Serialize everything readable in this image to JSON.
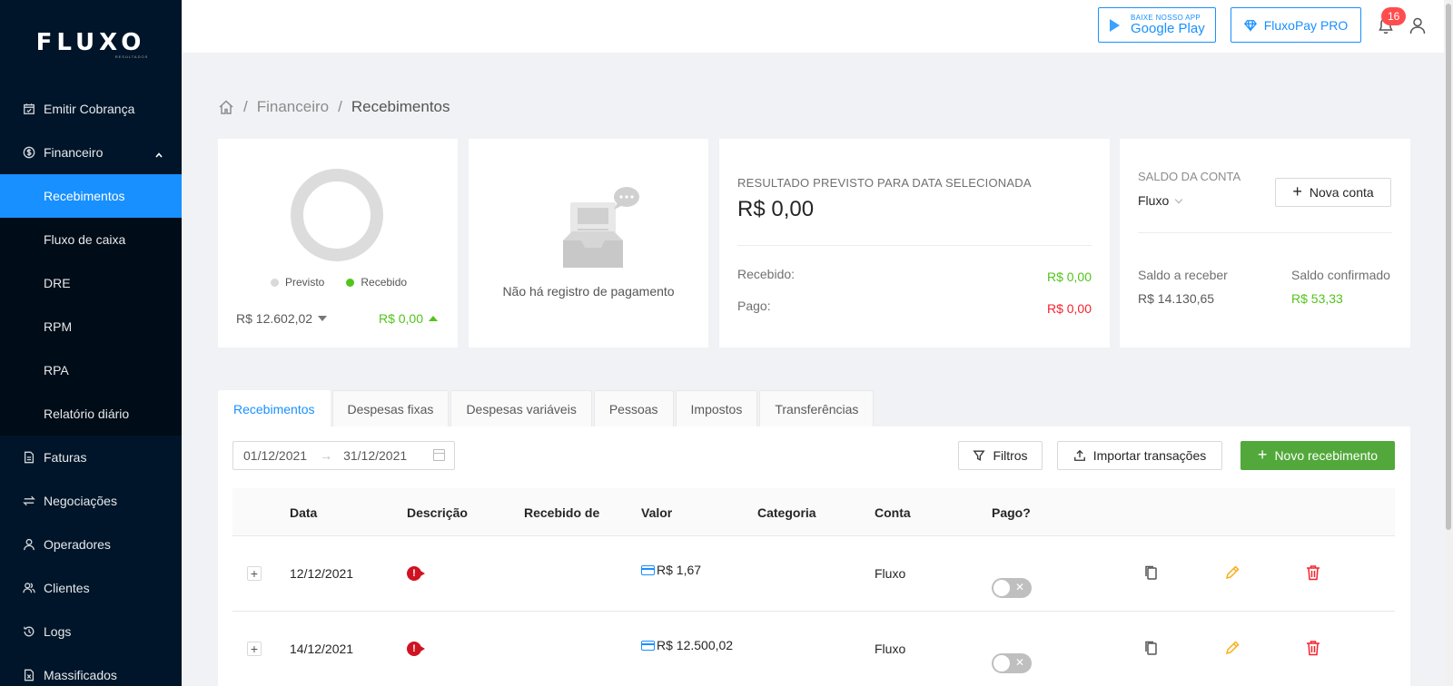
{
  "brand": {
    "logo": "FLUXO",
    "logo_sub": "RESULTADOS"
  },
  "sidebar": {
    "items": [
      {
        "label": "Emitir Cobrança",
        "icon": "calendar-icon"
      },
      {
        "label": "Financeiro",
        "icon": "dollar-icon",
        "expanded": true
      },
      {
        "label": "Faturas",
        "icon": "file-icon"
      },
      {
        "label": "Negociações",
        "icon": "swap-icon"
      },
      {
        "label": "Operadores",
        "icon": "user-icon"
      },
      {
        "label": "Clientes",
        "icon": "team-icon"
      },
      {
        "label": "Logs",
        "icon": "history-icon"
      },
      {
        "label": "Massificados",
        "icon": "file-excel-icon"
      }
    ],
    "submenu": [
      {
        "label": "Recebimentos",
        "active": true
      },
      {
        "label": "Fluxo de caixa"
      },
      {
        "label": "DRE"
      },
      {
        "label": "RPM"
      },
      {
        "label": "RPA"
      },
      {
        "label": "Relatório diário"
      }
    ]
  },
  "header": {
    "gplay_small": "BAIXE NOSSO APP",
    "gplay_big": "Google Play",
    "pro_label": "FluxoPay PRO",
    "notifications": "16"
  },
  "breadcrumb": {
    "items": [
      "Financeiro",
      "Recebimentos"
    ],
    "sep": "/"
  },
  "summary": {
    "legend_prev": "Previsto",
    "legend_rec": "Recebido",
    "prev_value": "R$ 12.602,02",
    "rec_value": "R$ 0,00",
    "colors": {
      "prev": "#d9d9d9",
      "rec": "#52c41a"
    }
  },
  "empty": {
    "text": "Não há registro de pagamento"
  },
  "result": {
    "label": "RESULTADO PREVISTO PARA DATA SELECIONADA",
    "value": "R$ 0,00",
    "received_label": "Recebido:",
    "received_value": "R$ 0,00",
    "paid_label": "Pago:",
    "paid_value": "R$ 0,00"
  },
  "account": {
    "label": "SALDO DA CONTA",
    "selected": "Fluxo",
    "new_button": "Nova conta",
    "receivable_label": "Saldo a receber",
    "receivable_value": "R$ 14.130,65",
    "confirmed_label": "Saldo confirmado",
    "confirmed_value": "R$ 53,33"
  },
  "tabs": [
    "Recebimentos",
    "Despesas fixas",
    "Despesas variáveis",
    "Pessoas",
    "Impostos",
    "Transferências"
  ],
  "toolbar": {
    "date_from": "01/12/2021",
    "date_to": "31/12/2021",
    "filters": "Filtros",
    "import": "Importar transações",
    "new": "Novo recebimento"
  },
  "table": {
    "columns": [
      "Data",
      "Descrição",
      "Recebido de",
      "Valor",
      "Categoria",
      "Conta",
      "Pago?"
    ],
    "rows": [
      {
        "date": "12/12/2021",
        "received_from": "",
        "value": "R$ 1,67",
        "category": "",
        "account": "Fluxo",
        "paid": false
      },
      {
        "date": "14/12/2021",
        "received_from": "",
        "value": "R$ 12.500,02",
        "category": "",
        "account": "Fluxo",
        "paid": false
      }
    ]
  }
}
